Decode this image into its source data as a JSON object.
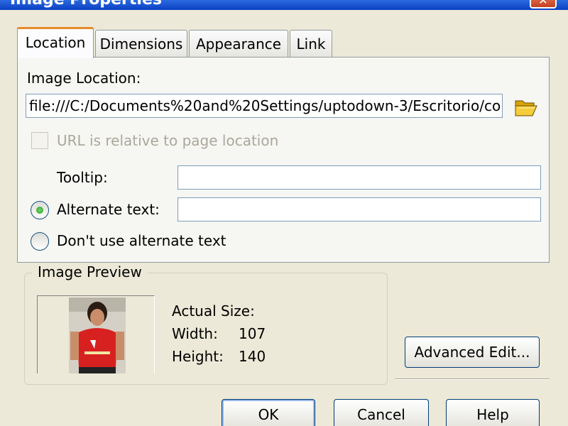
{
  "window": {
    "title": "Image Properties",
    "close_glyph": "✕"
  },
  "tabs": [
    {
      "label": "Location",
      "active": true
    },
    {
      "label": "Dimensions",
      "active": false
    },
    {
      "label": "Appearance",
      "active": false
    },
    {
      "label": "Link",
      "active": false
    }
  ],
  "location": {
    "image_location_label": "Image Location:",
    "image_location_value": "file:///C:/Documents%20and%20Settings/uptodown-3/Escritorio/co",
    "relative_label": "URL is relative to page location",
    "tooltip_label": "Tooltip:",
    "tooltip_value": "",
    "alt_text_label": "Alternate text:",
    "alt_text_value": "",
    "no_alt_label": "Don't use alternate text"
  },
  "preview": {
    "legend": "Image Preview",
    "actual_size_label": "Actual Size:",
    "width_label": "Width:",
    "width_value": "107",
    "height_label": "Height:",
    "height_value": "140",
    "advanced_edit_label": "Advanced Edit..."
  },
  "buttons": {
    "ok": "OK",
    "cancel": "Cancel",
    "help": "Help"
  },
  "colors": {
    "titlebar": "#0a3fc2",
    "dialog_bg": "#ece9d8",
    "tab_highlight": "#e68b2c",
    "radio_selected": "#21a121"
  }
}
